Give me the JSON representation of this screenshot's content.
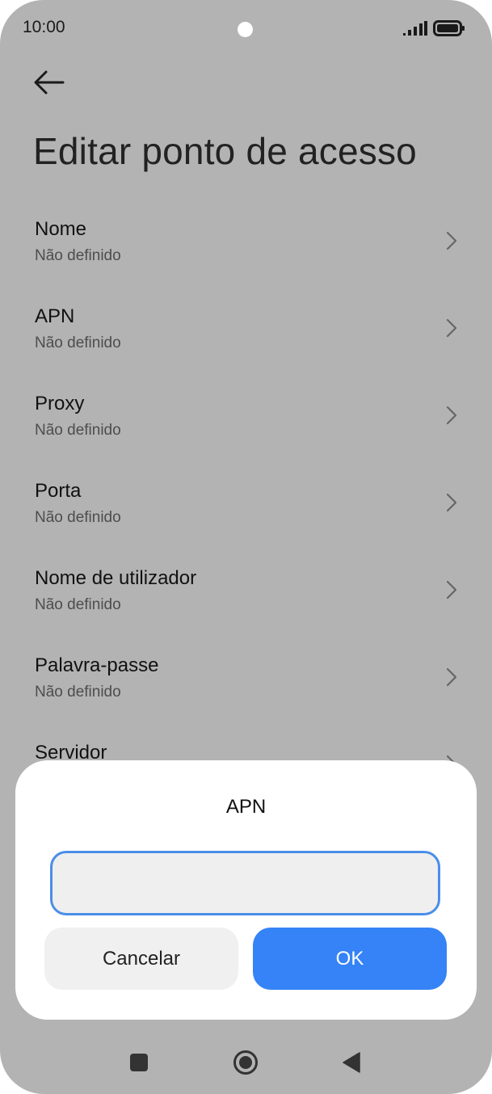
{
  "status_bar": {
    "time": "10:00",
    "icons": [
      "signal-icon",
      "battery-icon"
    ]
  },
  "header": {
    "back_icon": "arrow-left-icon",
    "title": "Editar ponto de acesso"
  },
  "settings": {
    "items": [
      {
        "label": "Nome",
        "value": "Não definido"
      },
      {
        "label": "APN",
        "value": "Não definido"
      },
      {
        "label": "Proxy",
        "value": "Não definido"
      },
      {
        "label": "Porta",
        "value": "Não definido"
      },
      {
        "label": "Nome de utilizador",
        "value": "Não definido"
      },
      {
        "label": "Palavra-passe",
        "value": "Não definido"
      },
      {
        "label": "Servidor",
        "value": ""
      }
    ]
  },
  "dialog": {
    "title": "APN",
    "input_value": "",
    "cancel_label": "Cancelar",
    "ok_label": "OK"
  },
  "colors": {
    "background_dim": "#b3b3b3",
    "accent": "#3583f6",
    "input_border": "#4a8ee8"
  },
  "nav_bar": {
    "icons": [
      "recents-square-icon",
      "home-circle-icon",
      "back-triangle-icon"
    ]
  }
}
